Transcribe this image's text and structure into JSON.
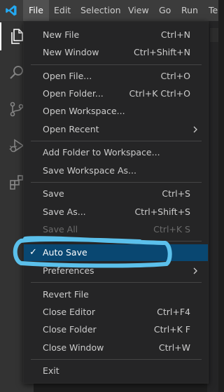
{
  "colors": {
    "menubar_bg": "#3c3c3c",
    "activitybar_bg": "#333333",
    "menu_bg": "#252526",
    "selection_bg": "#094771",
    "annotation_stroke": "#5bc0eb",
    "vscode_blue": "#23a9f2"
  },
  "menubar": {
    "items": [
      {
        "label": "File"
      },
      {
        "label": "Edit"
      },
      {
        "label": "Selection"
      },
      {
        "label": "View"
      },
      {
        "label": "Go"
      },
      {
        "label": "Run"
      },
      {
        "label": "Te"
      }
    ]
  },
  "activitybar": {
    "icons": [
      "files-icon",
      "search-icon",
      "source-control-icon",
      "run-debug-icon",
      "extensions-icon"
    ]
  },
  "file_menu": {
    "items": [
      {
        "label": "New File",
        "shortcut": "Ctrl+N"
      },
      {
        "label": "New Window",
        "shortcut": "Ctrl+Shift+N"
      },
      {
        "label": "Open File...",
        "shortcut": "Ctrl+O"
      },
      {
        "label": "Open Folder...",
        "shortcut": "Ctrl+K Ctrl+O"
      },
      {
        "label": "Open Workspace...",
        "shortcut": ""
      },
      {
        "label": "Open Recent",
        "shortcut": "",
        "submenu": true
      },
      {
        "label": "Add Folder to Workspace...",
        "shortcut": ""
      },
      {
        "label": "Save Workspace As...",
        "shortcut": ""
      },
      {
        "label": "Save",
        "shortcut": "Ctrl+S"
      },
      {
        "label": "Save As...",
        "shortcut": "Ctrl+Shift+S"
      },
      {
        "label": "Save All",
        "shortcut": "Ctrl+K S",
        "disabled": true
      },
      {
        "label": "Auto Save",
        "shortcut": "",
        "checked": true,
        "check_glyph": "✓",
        "selected": true
      },
      {
        "label": "Preferences",
        "shortcut": "",
        "submenu": true
      },
      {
        "label": "Revert File",
        "shortcut": ""
      },
      {
        "label": "Close Editor",
        "shortcut": "Ctrl+F4"
      },
      {
        "label": "Close Folder",
        "shortcut": "Ctrl+K F"
      },
      {
        "label": "Close Window",
        "shortcut": "Ctrl+W"
      },
      {
        "label": "Exit",
        "shortcut": ""
      }
    ]
  }
}
